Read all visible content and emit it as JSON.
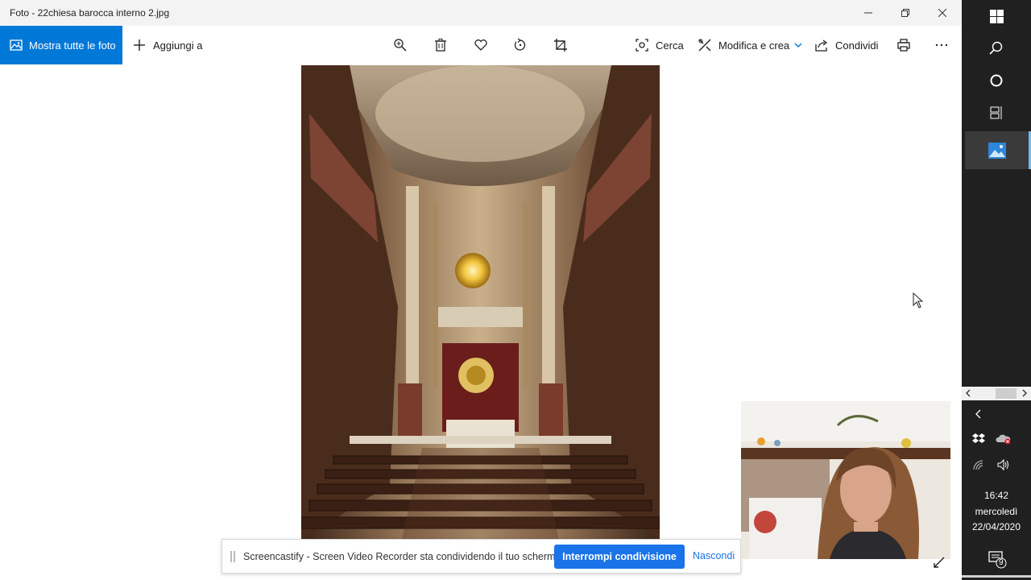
{
  "window": {
    "title": "Foto - 22chiesa barocca interno 2.jpg"
  },
  "toolbar": {
    "all_photos": "Mostra tutte le foto",
    "add_to": "Aggiungi a",
    "search": "Cerca",
    "edit_create": "Modifica e crea",
    "share": "Condividi",
    "icons": [
      "zoom-icon",
      "delete-icon",
      "favorite-icon",
      "rotate-icon",
      "crop-icon",
      "print-icon",
      "more-icon"
    ]
  },
  "share_banner": {
    "message": "Screencastify - Screen Video Recorder sta condividendo il tuo schermo.",
    "stop_label": "Interrompi condivisione",
    "hide_label": "Nascondi"
  },
  "taskbar": {
    "time": "16:42",
    "day": "mercoledì",
    "date": "22/04/2020",
    "notification_count": "9"
  },
  "colors": {
    "accent": "#0078d7",
    "share_button": "#1a73e8",
    "taskbar": "#202020"
  }
}
